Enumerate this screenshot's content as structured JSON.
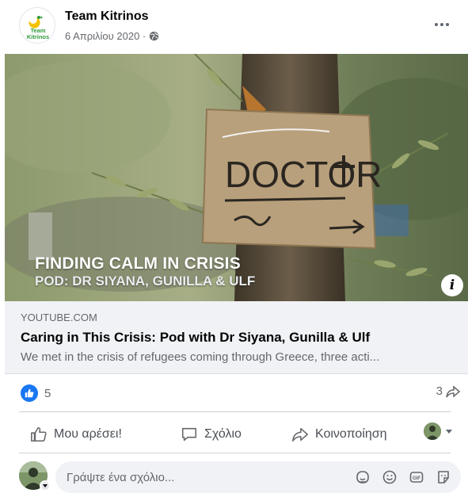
{
  "post": {
    "author": "Team Kitrinos",
    "avatar_text": [
      "Team",
      "Kitrinos"
    ],
    "date": "6 Απριλίου 2020 ·",
    "privacy_icon": "globe-icon",
    "more_icon": "ellipsis-icon"
  },
  "media": {
    "overlay_title": "FINDING CALM IN CRISIS",
    "overlay_subtitle": "POD: DR SIYANA, GUNILLA & ULF",
    "sign_text": "DOCTOR",
    "info_label": "i"
  },
  "link": {
    "domain": "YOUTUBE.COM",
    "title": "Caring in This Crisis: Pod with Dr Siyana, Gunilla & Ulf",
    "description": "We met in the crisis of refugees coming through Greece, three acti..."
  },
  "stats": {
    "reaction_count": "5",
    "share_count": "3"
  },
  "actions": {
    "like": "Μου αρέσει!",
    "comment": "Σχόλιο",
    "share": "Κοινοποίηση"
  },
  "comment": {
    "placeholder": "Γράψτε ένα σχόλιο...",
    "icons": [
      "sticker-face-icon",
      "emoji-icon",
      "gif-icon",
      "sticker-icon"
    ]
  },
  "colors": {
    "accent": "#1877f2",
    "secondary_text": "#65676b",
    "link_bg": "#f0f2f5"
  }
}
